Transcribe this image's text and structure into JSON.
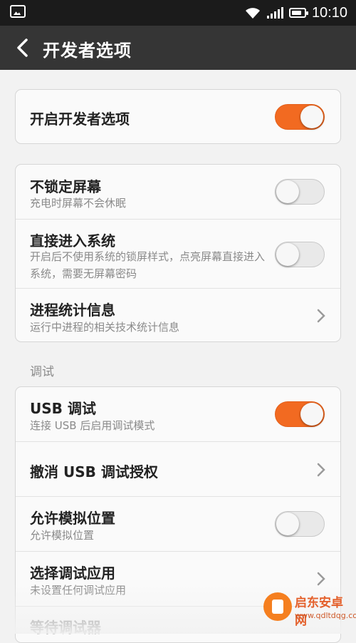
{
  "status_bar": {
    "time": "10:10",
    "battery_level": 0.8,
    "icons": [
      "image-icon",
      "wifi-icon",
      "signal-icon",
      "battery-icon"
    ]
  },
  "header": {
    "title": "开发者选项",
    "back_icon": "chevron-left-icon"
  },
  "colors": {
    "accent": "#f26a21",
    "header_bg": "#353535",
    "status_bg": "#1b1b1b"
  },
  "cards": [
    {
      "rows": [
        {
          "title": "开启开发者选项",
          "control": "toggle",
          "on": true
        }
      ]
    },
    {
      "rows": [
        {
          "title": "不锁定屏幕",
          "subtitle": "充电时屏幕不会休眠",
          "control": "toggle",
          "on": false
        },
        {
          "title": "直接进入系统",
          "subtitle": "开启后不使用系统的锁屏样式，点亮屏幕直接进入系统，需要无屏幕密码",
          "control": "toggle",
          "on": false
        },
        {
          "title": "进程统计信息",
          "subtitle": "运行中进程的相关技术统计信息",
          "control": "chevron"
        }
      ]
    },
    {
      "rows": [
        {
          "title": "USB 调试",
          "subtitle": "连接 USB 后启用调试模式",
          "control": "toggle",
          "on": true
        },
        {
          "title": "撤消 USB 调试授权",
          "control": "chevron"
        },
        {
          "title": "允许模拟位置",
          "subtitle": "允许模拟位置",
          "control": "toggle",
          "on": false
        },
        {
          "title": "选择调试应用",
          "subtitle": "未设置任何调试应用",
          "control": "chevron"
        },
        {
          "title": "等待调试器"
        }
      ]
    }
  ],
  "section_label": "调试",
  "watermark": {
    "name": "启东安卓网",
    "url": "www.qdltdqg.com"
  }
}
